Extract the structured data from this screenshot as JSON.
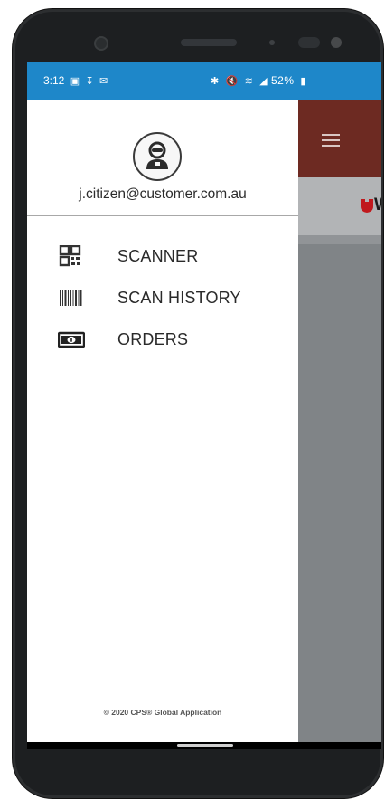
{
  "status_bar": {
    "time": "3:12",
    "left_icons": [
      "gallery-icon",
      "download-icon",
      "mail-icon"
    ],
    "right_text": "52%",
    "right_icons": [
      "bluetooth-icon",
      "mute-icon",
      "wifi-icon",
      "signal-icon",
      "battery-icon"
    ]
  },
  "drawer": {
    "user_email": "j.citizen@customer.com.au",
    "menu": [
      {
        "label": "SCANNER",
        "icon": "qr-code-icon"
      },
      {
        "label": "SCAN HISTORY",
        "icon": "barcode-icon"
      },
      {
        "label": "ORDERS",
        "icon": "banknote-icon"
      }
    ],
    "footer": "© 2020 CPS® Global Application"
  },
  "app_behind": {
    "brand_letter": "W",
    "header_color": "#6d2a22",
    "brand_color": "#c0191d"
  },
  "colors": {
    "status_bar": "#1e87c9",
    "drawer_bg": "#ffffff",
    "scrim": "#808487"
  }
}
